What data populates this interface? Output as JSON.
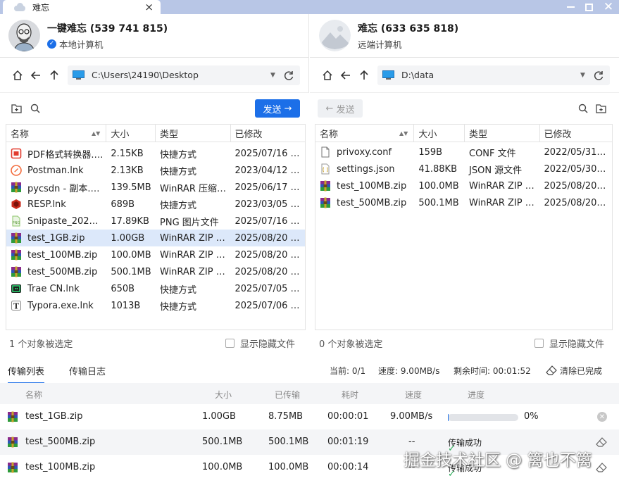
{
  "window": {
    "tab_title": "难忘",
    "tab_close": "×",
    "close_glyph": "✕"
  },
  "local": {
    "name": "一键难忘 (539 741 815)",
    "sub": "本地计算机",
    "path": "C:\\Users\\24190\\Desktop",
    "send_label": "发送",
    "status_text": "1 个对象被选定",
    "hidden_label": "显示隐藏文件",
    "columns": [
      "名称",
      "大小",
      "类型",
      "已修改"
    ],
    "files": [
      {
        "name": "PDF格式转换器.…",
        "size": "2.15KB",
        "type": "快捷方式",
        "modified": "2025/07/16 …",
        "icon": "pdf-icon"
      },
      {
        "name": "Postman.lnk",
        "size": "2.13KB",
        "type": "快捷方式",
        "modified": "2023/04/12 …",
        "icon": "postman-icon"
      },
      {
        "name": "pycsdn - 副本.…",
        "size": "139.5MB",
        "type": "WinRAR 压缩…",
        "modified": "2025/06/17 …",
        "icon": "winrar-icon"
      },
      {
        "name": "RESP.lnk",
        "size": "689B",
        "type": "快捷方式",
        "modified": "2023/03/05 …",
        "icon": "resp-icon"
      },
      {
        "name": "Snipaste_202…",
        "size": "17.89KB",
        "type": "PNG 图片文件",
        "modified": "2025/07/16 …",
        "icon": "png-icon"
      },
      {
        "name": "test_1GB.zip",
        "size": "1.00GB",
        "type": "WinRAR ZIP …",
        "modified": "2025/08/20 …",
        "icon": "winrar-icon",
        "selected": true
      },
      {
        "name": "test_100MB.zip",
        "size": "100.0MB",
        "type": "WinRAR ZIP …",
        "modified": "2025/08/20 …",
        "icon": "winrar-icon"
      },
      {
        "name": "test_500MB.zip",
        "size": "500.1MB",
        "type": "WinRAR ZIP …",
        "modified": "2025/08/20 …",
        "icon": "winrar-icon"
      },
      {
        "name": "Trae CN.lnk",
        "size": "650B",
        "type": "快捷方式",
        "modified": "2025/07/05 …",
        "icon": "trae-icon"
      },
      {
        "name": "Typora.exe.lnk",
        "size": "1013B",
        "type": "快捷方式",
        "modified": "2025/07/06 …",
        "icon": "typora-icon"
      }
    ]
  },
  "remote": {
    "name": "难忘 (633 635 818)",
    "sub": "远端计算机",
    "path": "D:\\data",
    "send_label": "发送",
    "status_text": "0 个对象被选定",
    "hidden_label": "显示隐藏文件",
    "columns": [
      "名称",
      "大小",
      "类型",
      "已修改"
    ],
    "files": [
      {
        "name": "privoxy.conf",
        "size": "159B",
        "type": "CONF 文件",
        "modified": "2022/05/31…",
        "icon": "file-icon"
      },
      {
        "name": "settings.json",
        "size": "41.88KB",
        "type": "JSON 源文件",
        "modified": "2022/05/30…",
        "icon": "json-icon"
      },
      {
        "name": "test_100MB.zip",
        "size": "100.0MB",
        "type": "WinRAR ZIP …",
        "modified": "2025/08/20…",
        "icon": "winrar-icon"
      },
      {
        "name": "test_500MB.zip",
        "size": "500.1MB",
        "type": "WinRAR ZIP …",
        "modified": "2025/08/20…",
        "icon": "winrar-icon"
      }
    ]
  },
  "transfer": {
    "tab_list": "传输列表",
    "tab_log": "传输日志",
    "current": "当前: 0/1",
    "speed": "速度: 9.00MB/s",
    "remaining": "剩余时间: 00:01:52",
    "clear_label": "清除已完成",
    "columns": {
      "name": "名称",
      "size": "大小",
      "transferred": "已传输",
      "elapsed": "耗时",
      "speed": "速度",
      "progress": "进度"
    },
    "rows": [
      {
        "name": "test_1GB.zip",
        "size": "1.00GB",
        "transferred": "8.75MB",
        "elapsed": "00:00:01",
        "speed": "9.00MB/s",
        "progress_text": "0%",
        "progress": 0.01
      },
      {
        "name": "test_500MB.zip",
        "size": "500.1MB",
        "transferred": "500.1MB",
        "elapsed": "00:01:19",
        "speed": "--",
        "status": "传输成功"
      },
      {
        "name": "test_100MB.zip",
        "size": "100.0MB",
        "transferred": "100.0MB",
        "elapsed": "00:00:14",
        "speed": "--",
        "status": "传输成功"
      }
    ]
  },
  "watermark": "掘金技术社区 @ 篱也不篱"
}
